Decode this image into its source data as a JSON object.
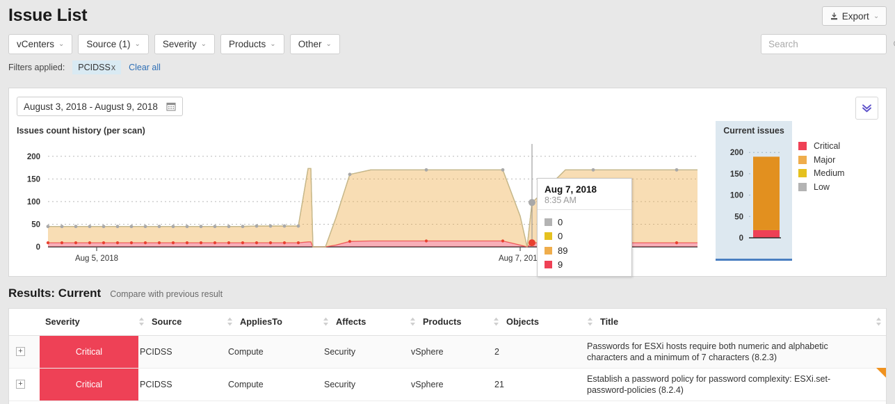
{
  "header": {
    "title": "Issue List",
    "export_label": "Export",
    "export_icon": "download-icon",
    "caret": "⌄"
  },
  "filters": {
    "buttons": [
      {
        "label": "vCenters",
        "name": "filter-vcenters"
      },
      {
        "label": "Source (1)",
        "name": "filter-source"
      },
      {
        "label": "Severity",
        "name": "filter-severity"
      },
      {
        "label": "Products",
        "name": "filter-products"
      },
      {
        "label": "Other",
        "name": "filter-other"
      }
    ],
    "applied_label": "Filters applied:",
    "applied_pills": [
      {
        "label": "PCIDSS",
        "remove": "x"
      }
    ],
    "clear_all": "Clear all"
  },
  "search": {
    "value": "",
    "placeholder": "Search",
    "icon": "search-icon"
  },
  "chart_card": {
    "date_range": "August 3, 2018 - August 9, 2018",
    "calendar_icon": "calendar-icon",
    "expand_icon": "double-chevron-down-icon",
    "title": "Issues count history (per scan)"
  },
  "tooltip": {
    "date": "Aug 7, 2018",
    "time": "8:35 AM",
    "rows": [
      {
        "color": "#b3b3b3",
        "value": "0",
        "series": "Low"
      },
      {
        "color": "#e5c11f",
        "value": "0",
        "series": "Medium"
      },
      {
        "color": "#efad4c",
        "value": "89",
        "series": "Major"
      },
      {
        "color": "#ef4155",
        "value": "9",
        "series": "Critical"
      }
    ]
  },
  "current_issues": {
    "title": "Current issues",
    "ticks": [
      "200",
      "150",
      "100",
      "50",
      "0"
    ],
    "stack": [
      {
        "series": "Critical",
        "value": 18,
        "color": "#ee4156"
      },
      {
        "series": "Major",
        "value": 172,
        "color": "#e2901f"
      }
    ],
    "total": 190
  },
  "legend": [
    {
      "label": "Critical",
      "color": "#ef4155"
    },
    {
      "label": "Major",
      "color": "#efad4c"
    },
    {
      "label": "Medium",
      "color": "#e5c11f"
    },
    {
      "label": "Low",
      "color": "#b3b3b3"
    }
  ],
  "chart_data": {
    "type": "area",
    "title": "Issues count history (per scan)",
    "xlabel": "",
    "ylabel": "",
    "ylim": [
      0,
      215
    ],
    "yticks": [
      0,
      50,
      100,
      150,
      200
    ],
    "grid": true,
    "legend_position": "right",
    "stacked": true,
    "xtick_labels": [
      "Aug 5, 2018",
      "Aug 7, 2018"
    ],
    "xtick_x": [
      126,
      735
    ],
    "hover_point": {
      "x": 752,
      "label": "Aug 7, 2018",
      "time": "8:35 AM"
    },
    "x": [
      56,
      76,
      96,
      116,
      136,
      156,
      176,
      196,
      216,
      236,
      256,
      276,
      296,
      316,
      336,
      356,
      376,
      396,
      416,
      430,
      434,
      437,
      455,
      470,
      490,
      520,
      560,
      600,
      640,
      680,
      710,
      735,
      745,
      752,
      760,
      800,
      840,
      880,
      920,
      960,
      990
    ],
    "series": [
      {
        "name": "Critical",
        "color": "#ef4155",
        "values": [
          9,
          9,
          9,
          9,
          9,
          9,
          9,
          9,
          9,
          9,
          9,
          9,
          9,
          9,
          9,
          9,
          9,
          9,
          9,
          11,
          11,
          0,
          0,
          4,
          12,
          13,
          13,
          13,
          13,
          13,
          13,
          4,
          0,
          9,
          9,
          9,
          9,
          9,
          9,
          9,
          9
        ]
      },
      {
        "name": "Major",
        "color": "#efad4c",
        "values": [
          36,
          36,
          36,
          36,
          36,
          36,
          36,
          36,
          36,
          36,
          36,
          36,
          36,
          36,
          36,
          37,
          37,
          37,
          37,
          162,
          162,
          0,
          0,
          60,
          148,
          157,
          157,
          157,
          157,
          157,
          157,
          64,
          0,
          89,
          100,
          161,
          161,
          161,
          161,
          161,
          161
        ]
      },
      {
        "name": "Medium",
        "color": "#e5c11f",
        "values": [
          0,
          0,
          0,
          0,
          0,
          0,
          0,
          0,
          0,
          0,
          0,
          0,
          0,
          0,
          0,
          0,
          0,
          0,
          0,
          0,
          0,
          0,
          0,
          0,
          0,
          0,
          0,
          0,
          0,
          0,
          0,
          0,
          0,
          0,
          0,
          0,
          0,
          0,
          0,
          0,
          0
        ]
      },
      {
        "name": "Low",
        "color": "#b3b3b3",
        "values": [
          0,
          0,
          0,
          0,
          0,
          0,
          0,
          0,
          0,
          0,
          0,
          0,
          0,
          0,
          0,
          0,
          0,
          0,
          0,
          0,
          0,
          0,
          0,
          0,
          0,
          0,
          0,
          0,
          0,
          0,
          0,
          0,
          0,
          0,
          0,
          0,
          0,
          0,
          0,
          0,
          0
        ]
      }
    ]
  },
  "results": {
    "title": "Results: Current",
    "compare_link": "Compare with previous result",
    "columns": [
      "Severity",
      "Source",
      "AppliesTo",
      "Affects",
      "Products",
      "Objects",
      "Title"
    ],
    "rows": [
      {
        "expander": "+",
        "severity": "Critical",
        "severity_color": "#ee4156",
        "source": "PCIDSS",
        "applies_to": "Compute",
        "affects": "Security",
        "products": "vSphere",
        "objects": "2",
        "title": "Passwords for ESXi hosts require both numeric and alphabetic characters and a minimum of 7 characters (8.2.3)",
        "flag": false
      },
      {
        "expander": "+",
        "severity": "Critical",
        "severity_color": "#ee4156",
        "source": "PCIDSS",
        "applies_to": "Compute",
        "affects": "Security",
        "products": "vSphere",
        "objects": "21",
        "title": "Establish a password policy for password complexity: ESXi.set-password-policies (8.2.4)",
        "flag": true
      }
    ]
  }
}
